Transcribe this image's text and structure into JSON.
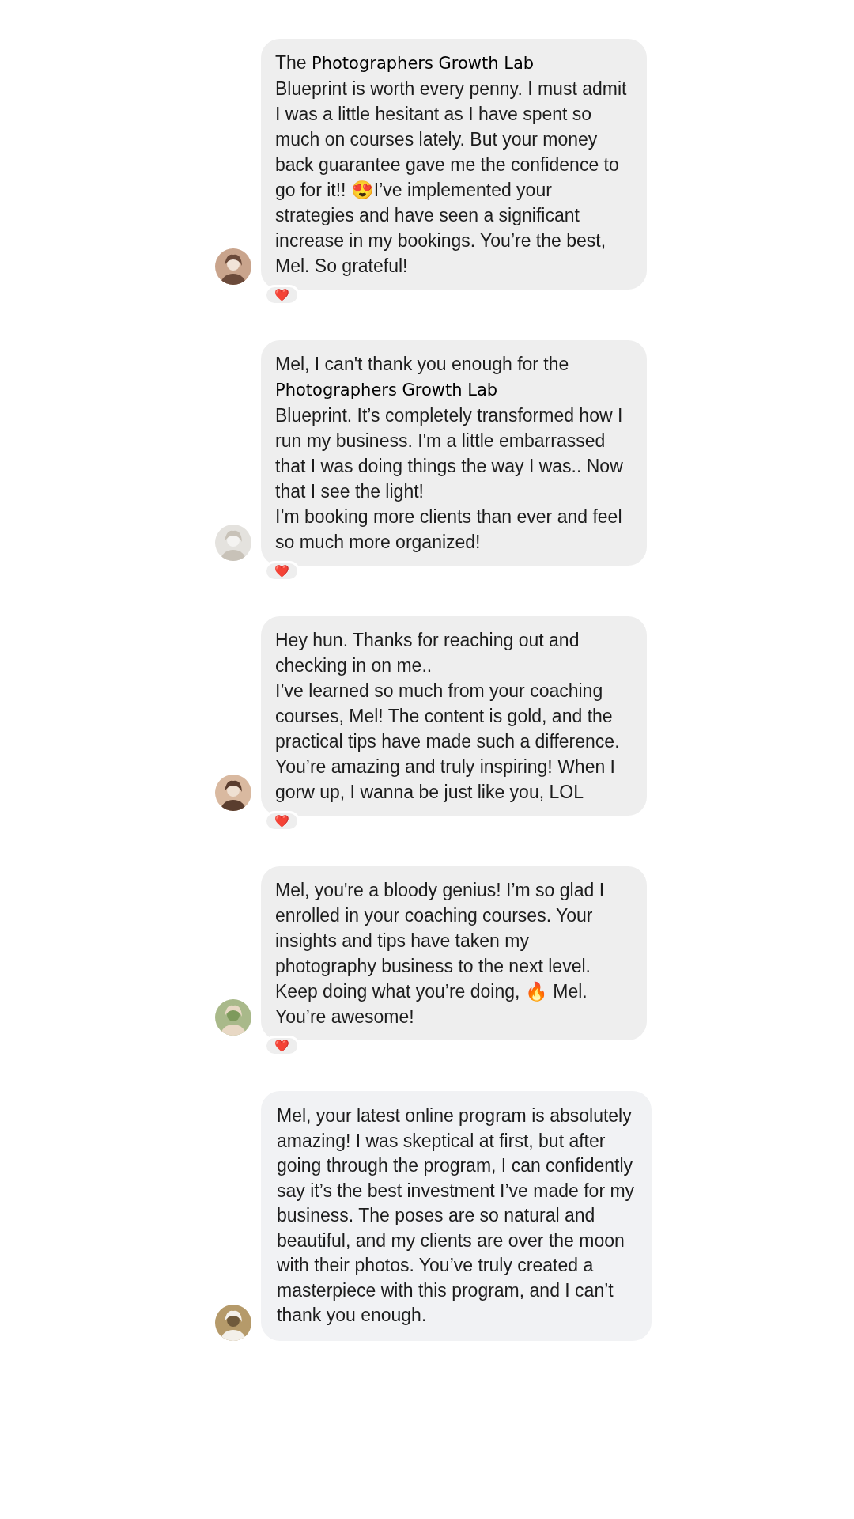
{
  "messages": [
    {
      "kind": "grey",
      "reaction": "❤️",
      "parts": [
        {
          "kind": "plain",
          "text": "The "
        },
        {
          "kind": "label",
          "text": "Photographers Growth Lab"
        },
        {
          "kind": "plain",
          "text": "\nBlueprint is worth every penny. I must admit I was a little hesitant as I have spent so much on courses lately. But your money back guarantee gave me the confidence to go for it!! 😍I’ve implemented your strategies and have seen a significant increase in my bookings. You’re the best, Mel. So grateful!"
        }
      ]
    },
    {
      "kind": "grey",
      "reaction": "❤️",
      "parts": [
        {
          "kind": "plain",
          "text": "Mel, I can't thank you enough for the\n"
        },
        {
          "kind": "label",
          "text": "Photographers Growth Lab"
        },
        {
          "kind": "plain",
          "text": "\nBlueprint. It’s completely transformed how I run my business. I'm a little embarrassed that I was doing things the way I was.. Now that I see the light!\nI’m booking more clients than ever and feel so much more organized!"
        }
      ]
    },
    {
      "kind": "grey",
      "reaction": "❤️",
      "parts": [
        {
          "kind": "plain",
          "text": "Hey hun. Thanks for reaching out and checking in on me..\nI’ve learned so much from your coaching courses, Mel! The content is gold, and the practical tips have made such a difference. You’re amazing and truly inspiring! When I gorw up, I wanna be just like you, LOL"
        }
      ]
    },
    {
      "kind": "grey",
      "reaction": "❤️",
      "parts": [
        {
          "kind": "plain",
          "text": "Mel, you're a bloody genius! I’m so glad I enrolled in your coaching courses. Your insights and tips have taken my photography business to the next level. Keep doing what you’re doing, 🔥 Mel. You’re awesome!"
        }
      ]
    },
    {
      "kind": "light",
      "parts": [
        {
          "kind": "plain",
          "text": "Mel, your latest online program is absolutely amazing! I was skeptical at first, but after going through the program, I can confidently say it’s the best investment I’ve made for my business. The poses are so natural and beautiful, and my clients are over the moon with their photos. You’ve truly created a masterpiece with this program, and I can’t thank you enough."
        }
      ]
    }
  ]
}
